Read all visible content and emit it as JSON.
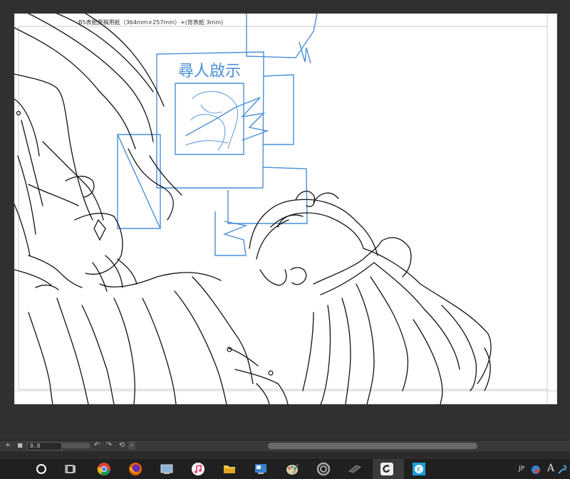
{
  "canvas": {
    "caption": "B5表紙原稿用紙（364mm×257mm）+(背表紙 3mm)",
    "poster_text": "尋人啟示"
  },
  "status_bar": {
    "zoom_value": "0.0",
    "add_glyph": "+",
    "stop_glyph": "■",
    "rotate_left_glyph": "↶",
    "rotate_right_glyph": "↷",
    "reset_glyph": "⟲",
    "collapse_glyph": "‹"
  },
  "taskbar": {
    "items": [
      "cortana",
      "task-view",
      "chrome",
      "firefox",
      "system",
      "itunes",
      "file-explorer",
      "remote-desktop",
      "paint",
      "unity-hub",
      "pen-tablet",
      "clip-studio-paint",
      "kolor-app"
    ],
    "tray_language": "JP",
    "tray_font_glyph": "A",
    "accent": "#4aa3e0"
  }
}
